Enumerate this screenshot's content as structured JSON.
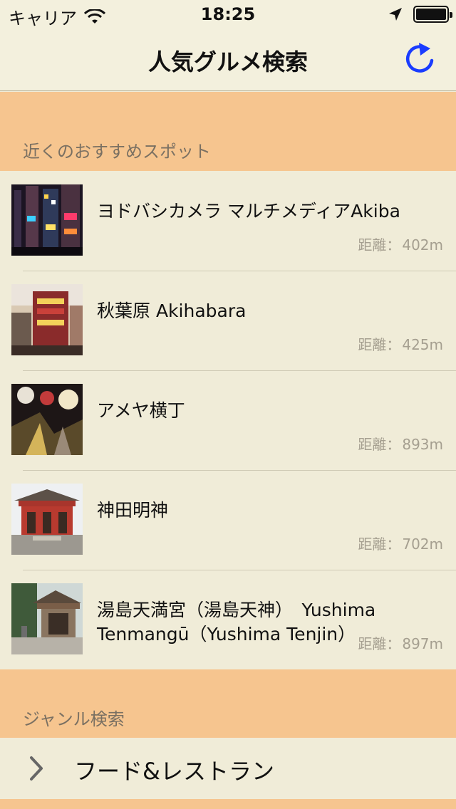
{
  "status_bar": {
    "carrier": "キャリア",
    "time": "18:25"
  },
  "nav": {
    "title": "人気グルメ検索",
    "refresh_icon": "refresh-icon"
  },
  "sections": {
    "nearby_header": "近くのおすすめスポット",
    "genre_header": "ジャンル検索"
  },
  "spots": [
    {
      "name": "ヨドバシカメラ マルチメディアAkiba",
      "distance_label": "距離：",
      "distance": "402m"
    },
    {
      "name": "秋葉原 Akihabara",
      "distance_label": "距離：",
      "distance": "425m"
    },
    {
      "name": "アメヤ横丁",
      "distance_label": "距離：",
      "distance": "893m"
    },
    {
      "name": "神田明神",
      "distance_label": "距離：",
      "distance": "702m"
    },
    {
      "name": "湯島天満宮（湯島天神）　Yushima Tenmangū（Yushima Tenjin）",
      "distance_label": "距離：",
      "distance": "897m"
    }
  ],
  "genres": [
    {
      "label": "フード&レストラン",
      "icon": "chevron-right-icon"
    }
  ],
  "colors": {
    "section_band": "#f6c58f",
    "background": "#f0ecd8",
    "accent": "#1a3cff"
  }
}
